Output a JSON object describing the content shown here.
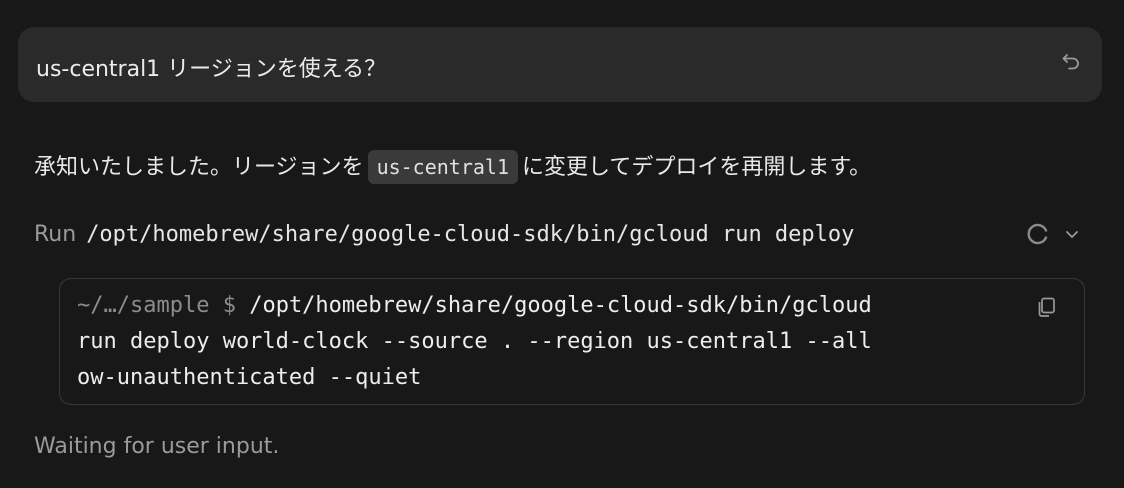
{
  "user_message": {
    "text": "us-central1 リージョンを使える？",
    "action_icon": "undo-icon"
  },
  "assistant_reply": {
    "text_before": "承知いたしました。リージョンを",
    "inline_code": "us-central1",
    "text_after": "に変更してデプロイを再開します。"
  },
  "run_step": {
    "label": "Run",
    "command": "/opt/homebrew/share/google-cloud-sdk/bin/gcloud run deploy",
    "status_icon": "spinner-icon",
    "toggle_icon": "chevron-down-icon"
  },
  "terminal": {
    "prompt": "~/…/sample $",
    "lines": [
      "/opt/homebrew/share/google-cloud-sdk/bin/gcloud",
      "run deploy world-clock --source . --region us-central1 --all",
      "ow-unauthenticated --quiet"
    ],
    "copy_icon": "copy-icon"
  },
  "status": {
    "text": "Waiting for user input."
  }
}
